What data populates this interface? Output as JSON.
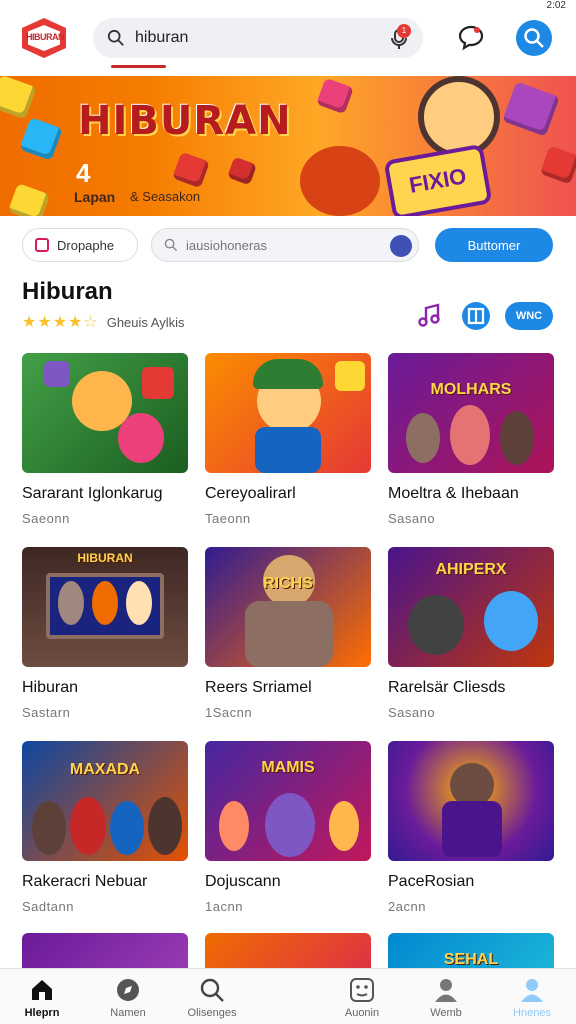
{
  "status": {
    "time": "2:02"
  },
  "header": {
    "logo_text": "HIBURAN",
    "search_value": "hiburan",
    "mic_badge": "1"
  },
  "banner": {
    "title": "HIBURAN",
    "number": "4",
    "sub1": "Lapan",
    "sub2": "& Seasakon",
    "sign": "FIXIO"
  },
  "filter": {
    "chip_label": "Dropaphe",
    "search_placeholder": "iausiohoneras",
    "button_label": "Buttomer"
  },
  "section": {
    "title": "Hiburan",
    "rating_stars": "★★★★☆",
    "rating_label": "Gheuis Aylkis",
    "pill_label": "WNC"
  },
  "cards": [
    {
      "title": "Sararant Iglonkarug",
      "meta": "Saeonn",
      "label": ""
    },
    {
      "title": "Cereyoalirarl",
      "meta": "Taeonn",
      "label": ""
    },
    {
      "title": "Moeltra & Ihebaan",
      "meta": "Sasano",
      "label": "MOLHARS"
    },
    {
      "title": "Hiburan",
      "meta": "Sastarn",
      "label": "HIBURAN"
    },
    {
      "title": "Reers Srriamel",
      "meta": "1Sacnn",
      "label": "RICHS"
    },
    {
      "title": "Rarelsär Cliesds",
      "meta": "Sasano",
      "label": "AHIPERX"
    },
    {
      "title": "Rakeracri Nebuar",
      "meta": "Sadtann",
      "label": "MAXADA"
    },
    {
      "title": "Dojuscann",
      "meta": "1acnn",
      "label": "MAMIS"
    },
    {
      "title": "PaceRosian",
      "meta": "2acnn",
      "label": ""
    },
    {
      "title": "",
      "meta": "",
      "label": ""
    },
    {
      "title": "",
      "meta": "",
      "label": ""
    },
    {
      "title": "",
      "meta": "",
      "label": "SEHAL"
    }
  ],
  "nav": [
    {
      "label": "Hleprn",
      "icon": "home-icon"
    },
    {
      "label": "Namen",
      "icon": "compass-icon"
    },
    {
      "label": "Olisenges",
      "icon": "search-icon"
    },
    {
      "label": "Auonin",
      "icon": "game-icon"
    },
    {
      "label": "Wemb",
      "icon": "user-icon"
    },
    {
      "label": "Hnenes",
      "icon": "profile-icon"
    }
  ],
  "colors": {
    "accent": "#1e88e5",
    "brand": "#e53935",
    "star": "#fbc02d"
  }
}
